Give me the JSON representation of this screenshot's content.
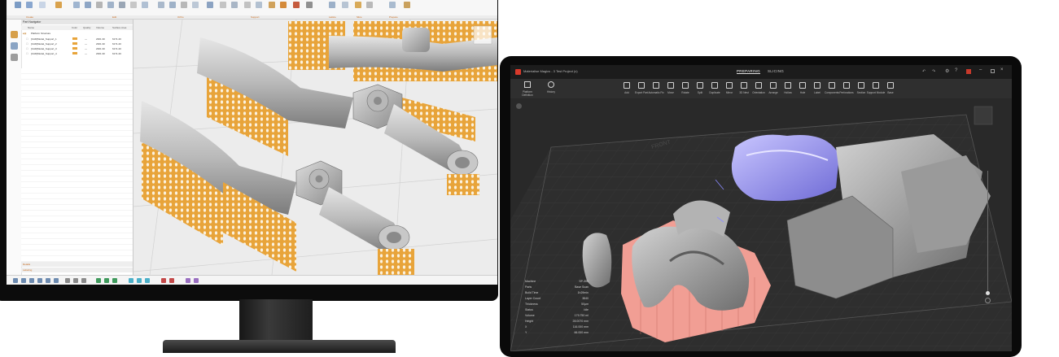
{
  "left_app": {
    "ribbon_groups": [
      "Create",
      "Edit",
      "Ortho",
      "Support",
      "Lattice",
      "Slice",
      "Prepare"
    ],
    "side_tools": [
      "folder-icon",
      "move-icon",
      "tree-icon"
    ],
    "tree": {
      "header": "Part Navigator",
      "columns": [
        "Name",
        "Color",
        "Quality",
        "Volume",
        "Surface Area"
      ],
      "root": "Platform Structure",
      "rows": [
        {
          "name": "[CAD]Model_Support_1",
          "color": "orange",
          "quality": "—",
          "volume": "2301.30",
          "surface": "6171.20"
        },
        {
          "name": "[CAD]Model_Support_2",
          "color": "orange",
          "quality": "—",
          "volume": "2301.30",
          "surface": "6171.20"
        },
        {
          "name": "[CAD]Model_Support_3",
          "color": "orange",
          "quality": "—",
          "volume": "2301.30",
          "surface": "6171.20"
        },
        {
          "name": "[CAD]Model_Support_4",
          "color": "orange",
          "quality": "—",
          "volume": "2301.30",
          "surface": "6171.20"
        }
      ],
      "footers": [
        "Details",
        "Labeling"
      ]
    }
  },
  "right_app": {
    "title": "Materialise Magics - 3 Test Project (v)",
    "tabs": [
      "PREPARING",
      "SLICING"
    ],
    "left_tools": [
      "Platform Definition",
      "History"
    ],
    "toolbar": [
      "Add",
      "Export Part",
      "Automatic Fix",
      "Move",
      "Rotate",
      "Split",
      "Duplicate",
      "Mirror",
      "3D Nest",
      "Orientation",
      "Arrange",
      "Hollow",
      "Hole",
      "Label",
      "Components",
      "Perforations",
      "Section",
      "Support Module",
      "Base"
    ],
    "platform_label": "FRONT",
    "info": [
      {
        "k": "Machine",
        "v": "SP-300"
      },
      {
        "k": "Parts",
        "v": "Base Scan"
      },
      {
        "k": "Build Time",
        "v": "1h29min"
      },
      {
        "k": "Layer Count",
        "v": "3840"
      },
      {
        "k": "Thickness",
        "v": "50µm"
      },
      {
        "k": "Status",
        "v": "Idle"
      },
      {
        "k": "Volume",
        "v": "179.750 ml"
      },
      {
        "k": "Height",
        "v": "28.0070 mm"
      },
      {
        "k": "X",
        "v": "116.000 mm"
      },
      {
        "k": "Y",
        "v": "66.000 mm"
      }
    ]
  },
  "colors": {
    "support_orange": "#e8a43a",
    "part_grey": "#9c9c9c",
    "model_lavender": "#a8a4f0",
    "support_pink": "#f19e94",
    "brand_red": "#d93a2b"
  }
}
